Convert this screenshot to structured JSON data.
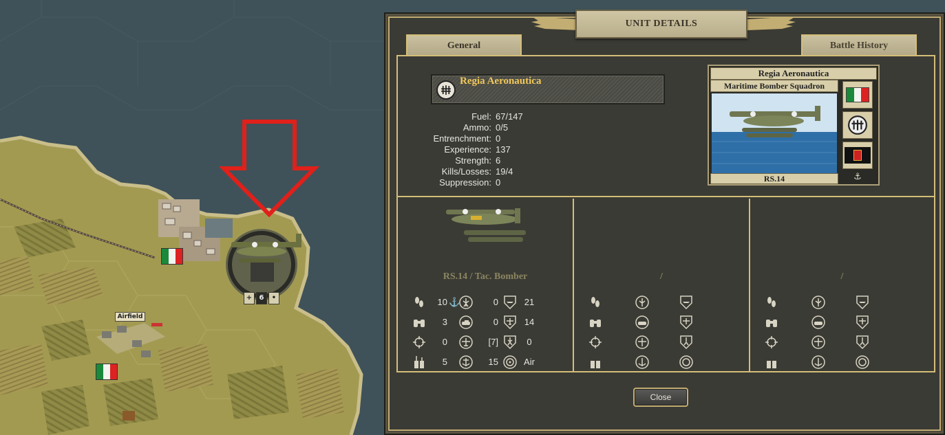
{
  "map": {
    "airfield_label": "Airfield",
    "unit_badge": [
      "+",
      "6",
      "•"
    ],
    "arrow_color": "#e0201a",
    "sea_color": "#3f525a",
    "land_color": "#a39a52"
  },
  "panel": {
    "title": "UNIT DETAILS",
    "tabs": {
      "general": "General",
      "battle_history": "Battle History"
    },
    "unit_name": "Regia Aeronautica",
    "stats": [
      {
        "label": "Fuel:",
        "value": "67/147"
      },
      {
        "label": "Ammo:",
        "value": "0/5"
      },
      {
        "label": "Entrenchment:",
        "value": "0"
      },
      {
        "label": "Experience:",
        "value": "137"
      },
      {
        "label": "Strength:",
        "value": "6"
      },
      {
        "label": "Kills/Losses:",
        "value": "19/4"
      },
      {
        "label": "Suppression:",
        "value": "0"
      }
    ],
    "card": {
      "header": "Regia Aeronautica",
      "subtitle": "Maritime Bomber Squadron",
      "model": "RS.14",
      "side_icons": [
        "italy-flag-icon",
        "branch-emblem-icon",
        "regia-marina-flag-icon",
        "anchor-icon"
      ],
      "anchor_glyph": "⚓"
    },
    "slots": [
      {
        "name": "RS.14 / Tac. Bomber",
        "rows": [
          {
            "a": "10",
            "b": "0",
            "c": "21"
          },
          {
            "a": "3",
            "b": "0",
            "c": "14"
          },
          {
            "a": "0",
            "b": "[7]",
            "c": "0"
          },
          {
            "a": "5",
            "b": "15",
            "c": "Air"
          }
        ]
      },
      {
        "name": "/",
        "rows": [
          {
            "a": "",
            "b": "",
            "c": ""
          },
          {
            "a": "",
            "b": "",
            "c": ""
          },
          {
            "a": "",
            "b": "",
            "c": ""
          },
          {
            "a": "",
            "b": "",
            "c": ""
          }
        ]
      },
      {
        "name": "/",
        "rows": [
          {
            "a": "",
            "b": "",
            "c": ""
          },
          {
            "a": "",
            "b": "",
            "c": ""
          },
          {
            "a": "",
            "b": "",
            "c": ""
          },
          {
            "a": "",
            "b": "",
            "c": ""
          }
        ]
      }
    ],
    "row1_move_type_glyph": "⚓",
    "close_label": "Close"
  }
}
